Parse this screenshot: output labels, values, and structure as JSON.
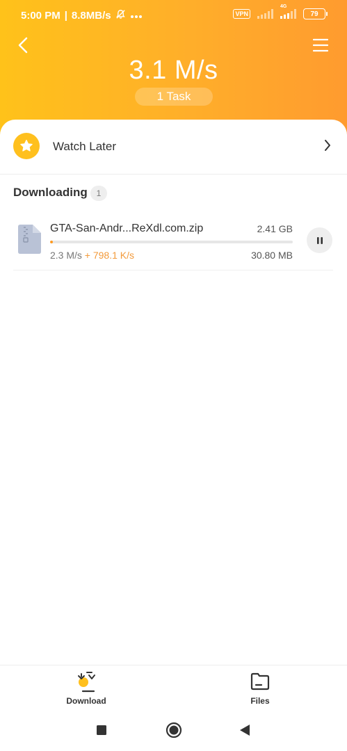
{
  "status_bar": {
    "time": "5:00 PM",
    "net_speed": "8.8MB/s",
    "vpn_label": "VPN",
    "network_type": "4G",
    "battery": "79"
  },
  "header": {
    "total_speed": "3.1 M/s",
    "task_count": "1 Task",
    "gradient_colors": [
      "#ffc21a",
      "#ff9b2f"
    ]
  },
  "watch_later": {
    "label": "Watch Later",
    "icon": "star-icon",
    "accent": "#ffc01e"
  },
  "downloading": {
    "title": "Downloading",
    "count": "1",
    "items": [
      {
        "name": "GTA-San-Andr...ReXdl.com.zip",
        "total_size": "2.41 GB",
        "speed": "2.3 M/s",
        "extra_speed": "+ 798.1 K/s",
        "downloaded": "30.80 MB",
        "progress_fraction": 0.0125,
        "icon": "zip-file-icon",
        "action_icon": "pause-icon"
      }
    ]
  },
  "bottom_nav": {
    "items": [
      {
        "label": "Download",
        "icon": "download-icon",
        "active": true
      },
      {
        "label": "Files",
        "icon": "folder-icon",
        "active": false
      }
    ]
  },
  "system_nav": {
    "icons": [
      "recents-icon",
      "home-icon",
      "back-icon"
    ]
  },
  "colors": {
    "accent_orange": "#ff9a1f",
    "extra_speed_orange": "#f39a3a",
    "badge_bg": "#eeeeee"
  }
}
